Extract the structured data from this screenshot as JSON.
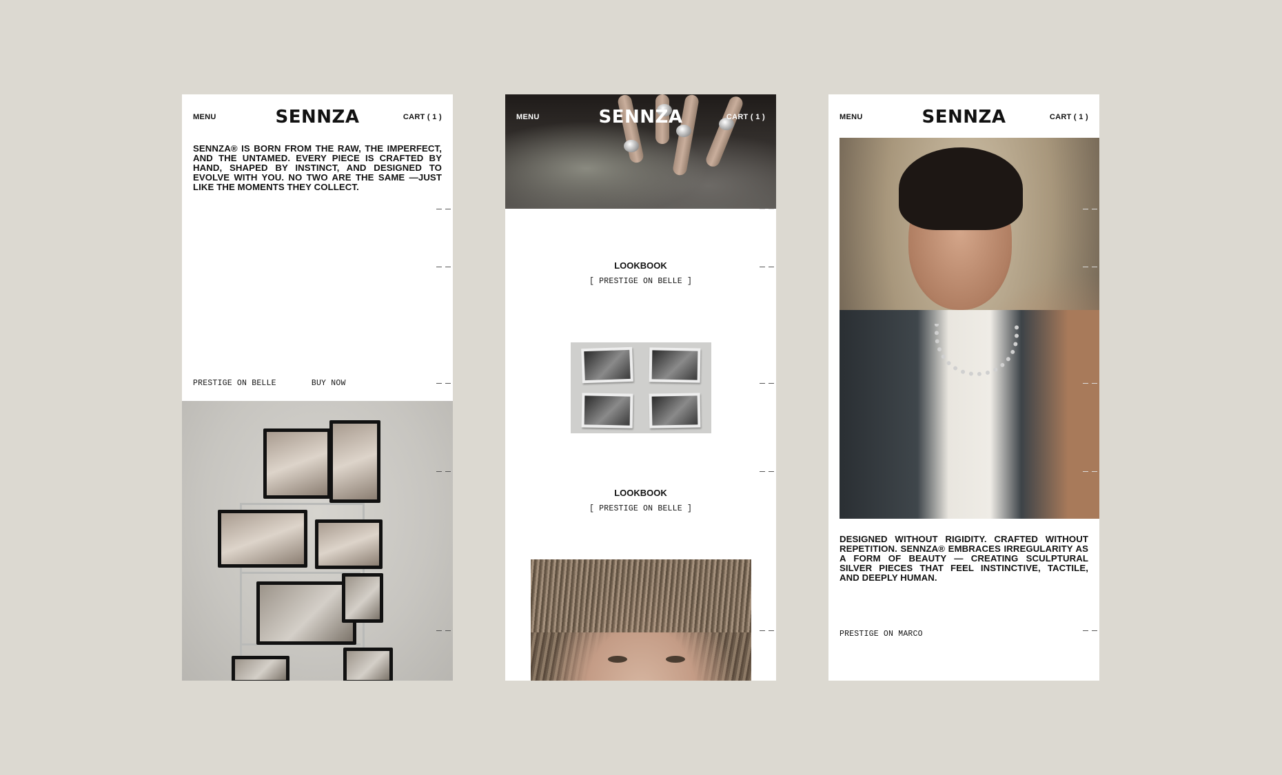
{
  "brand": "SENNZA",
  "nav": {
    "menu_label": "MENU",
    "cart_label": "CART ( 1 )"
  },
  "screen1": {
    "intro_text": "SENNZA® IS BORN FROM THE RAW, THE IMPERFECT, AND THE UNTAMED. EVERY PIECE IS CRAFTED BY HAND, SHAPED BY INSTINCT, AND DESIGNED TO EVOLVE WITH YOU. NO TWO ARE THE SAME —JUST LIKE THE MOMENTS THEY COLLECT.",
    "collection_link": "PRESTIGE ON BELLE",
    "buy_link": "BUY NOW"
  },
  "screen2": {
    "lookbooks": [
      {
        "title": "LOOKBOOK",
        "subtitle": "[ PRESTIGE ON BELLE ]"
      },
      {
        "title": "LOOKBOOK",
        "subtitle": "[ PRESTIGE ON BELLE ]"
      }
    ]
  },
  "screen3": {
    "body_text": "DESIGNED WITHOUT RIGIDITY. CRAFTED WITHOUT REPETITION. SENNZA® EMBRACES IRREGULARITY AS A FORM OF BEAUTY — CREATING SCULPTURAL SILVER PIECES THAT FEEL INSTINCTIVE, TACTILE, AND DEEPLY HUMAN.",
    "collection_link": "PRESTIGE ON MARCO"
  },
  "colors": {
    "background": "#dcd9d1",
    "screen": "#ffffff",
    "text": "#111111"
  }
}
